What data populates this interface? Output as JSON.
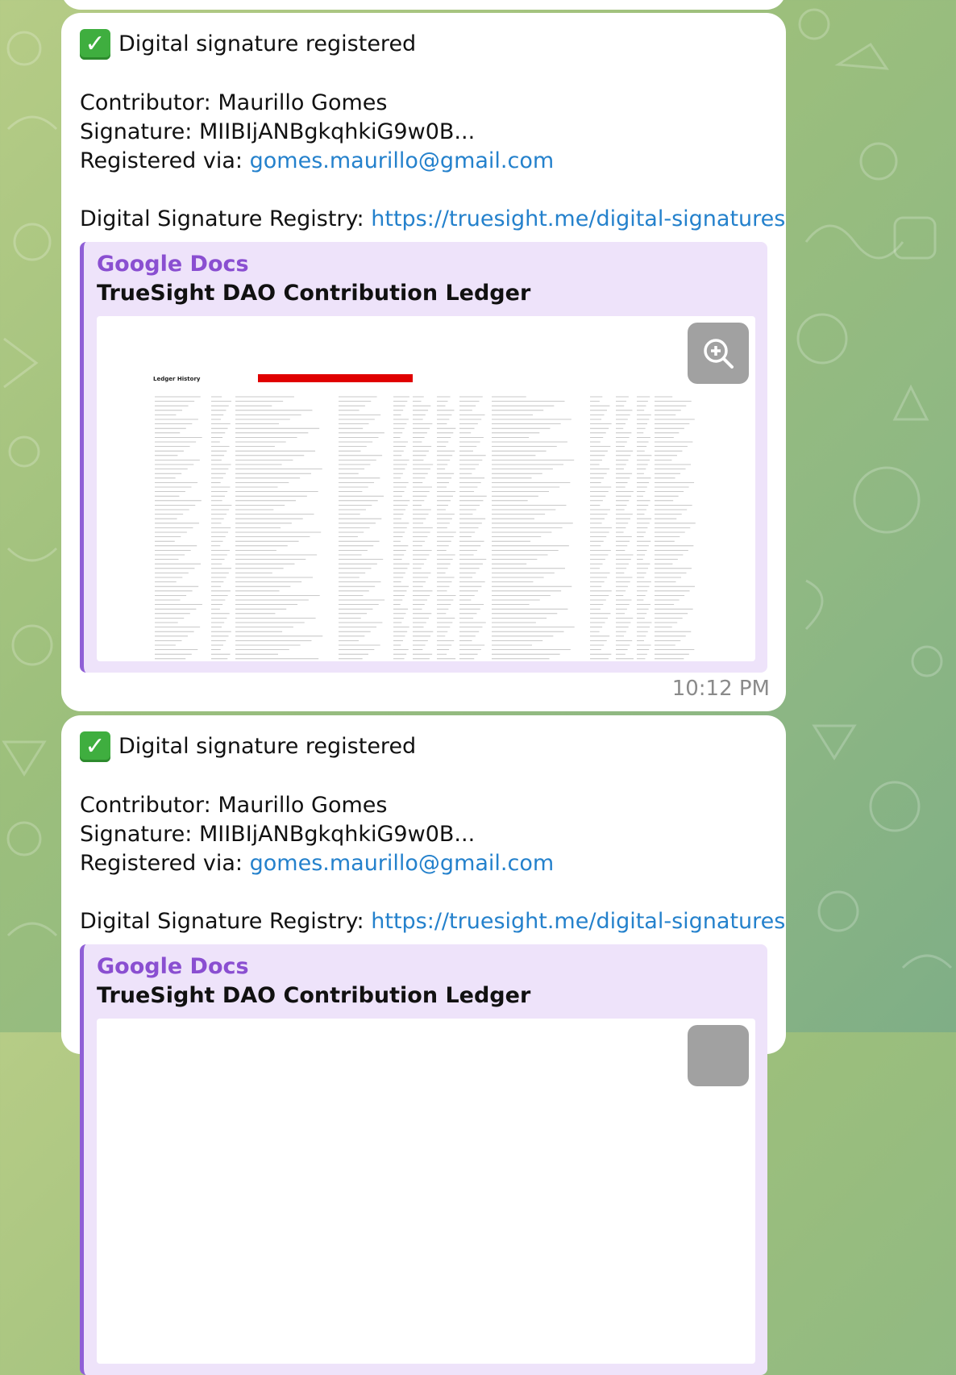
{
  "messages": [
    {
      "heading": "Digital signature registered",
      "contributor_label": "Contributor:",
      "contributor": "Maurillo Gomes",
      "signature_label": "Signature:",
      "signature": "MIIBIjANBgkqhkiG9w0B...",
      "registered_label": "Registered via:",
      "email": "gomes.maurillo@gmail.com",
      "registry_label": "Digital Signature Registry:",
      "registry_url": "https://truesight.me/digital-signatures",
      "preview": {
        "site": "Google Docs",
        "title": "TrueSight DAO Contribution Ledger",
        "sheet_title": "Ledger History"
      },
      "time": "10:12 PM"
    },
    {
      "heading": "Digital signature registered",
      "contributor_label": "Contributor:",
      "contributor": "Maurillo Gomes",
      "signature_label": "Signature:",
      "signature": "MIIBIjANBgkqhkiG9w0B...",
      "registered_label": "Registered via:",
      "email": "gomes.maurillo@gmail.com",
      "registry_label": "Digital Signature Registry:",
      "registry_url": "https://truesight.me/digital-signatures",
      "preview": {
        "site": "Google Docs",
        "title": "TrueSight DAO Contribution Ledger"
      }
    }
  ],
  "colors": {
    "link": "#2481cc",
    "preview_accent": "#8f5fd6",
    "preview_bg": "#eee3fa",
    "check_green": "#3fae3f"
  },
  "icons": {
    "check": "check-mark-button-icon",
    "zoom": "zoom-in-icon"
  }
}
